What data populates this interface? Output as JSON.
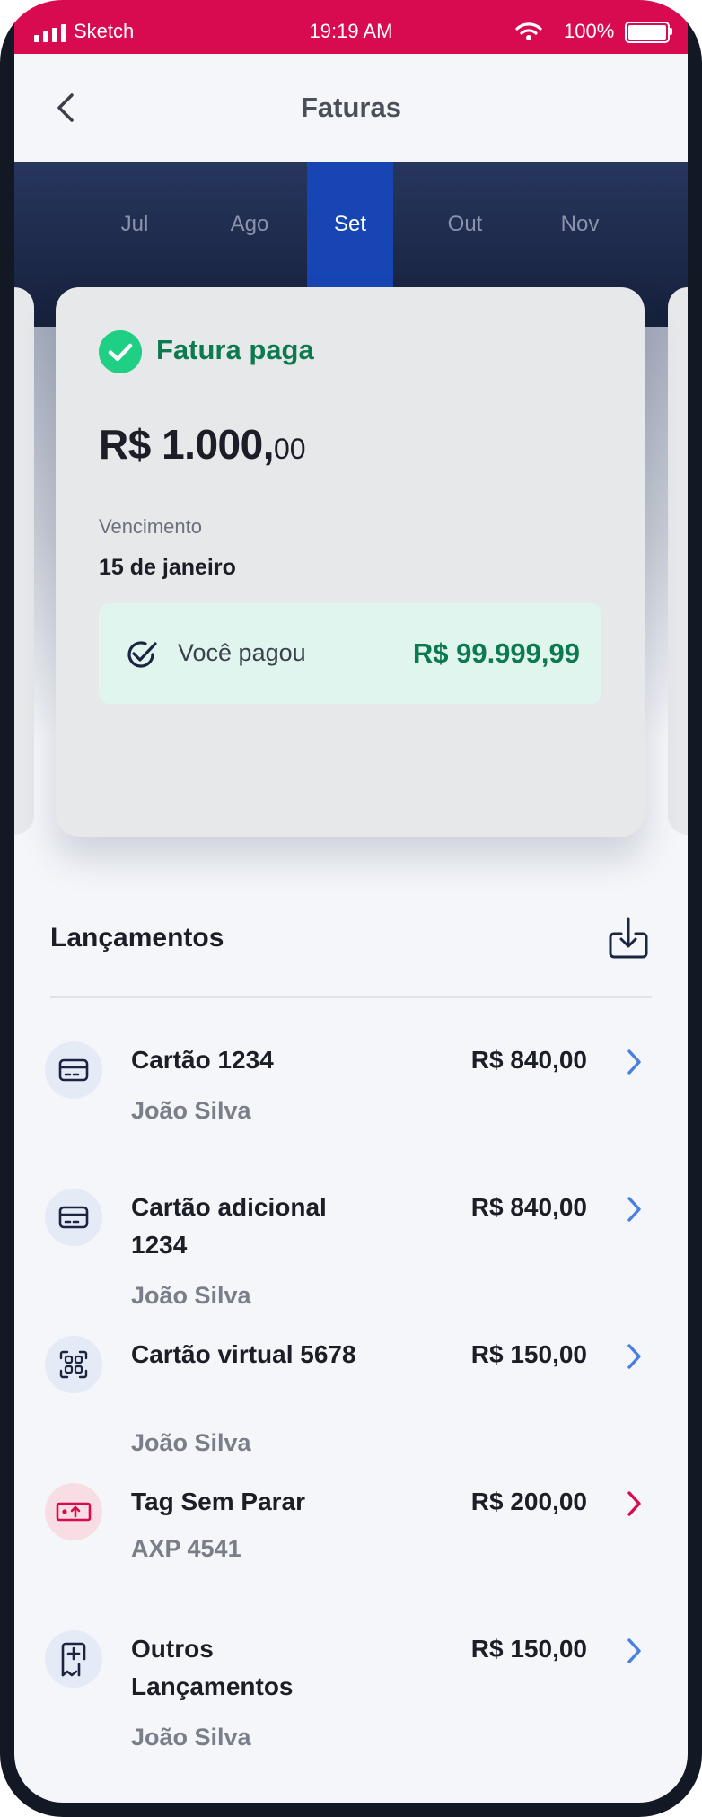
{
  "status_bar": {
    "carrier": "Sketch",
    "time": "19:19 AM",
    "battery": "100%"
  },
  "nav": {
    "title": "Faturas",
    "back_icon": "chevron-left-icon"
  },
  "months": [
    "Jul",
    "Ago",
    "Set",
    "Out",
    "Nov"
  ],
  "active_month": "Set",
  "invoice": {
    "status": "Fatura paga",
    "status_icon": "check-circle-icon",
    "amount_main": "R$ 1.000,",
    "amount_cents": "00",
    "due_label": "Vencimento",
    "due_date": "15 de janeiro",
    "paid_label": "Você pagou",
    "paid_amount": "R$ 99.999,99"
  },
  "entries_section": {
    "title": "Lançamentos",
    "download_icon": "download-icon"
  },
  "entries": [
    {
      "title": "Cartão 1234",
      "subtitle": "João Silva",
      "amount": "R$ 840,00",
      "icon": "credit-card-icon"
    },
    {
      "title": "Cartão  adicional 1234",
      "subtitle": "João Silva",
      "amount": "R$ 840,00",
      "icon": "credit-card-icon"
    },
    {
      "title": "Cartão  virtual 5678",
      "subtitle": "João Silva",
      "amount": "R$ 150,00",
      "icon": "virtual-card-icon"
    },
    {
      "title": "Tag Sem Parar",
      "subtitle": "AXP 4541",
      "amount": "R$ 200,00",
      "icon": "toll-tag-icon"
    },
    {
      "title": "Outros Lançamentos",
      "subtitle": "João Silva",
      "amount": "R$ 150,00",
      "icon": "receipt-plus-icon"
    }
  ],
  "colors": {
    "brand_red": "#d80a50",
    "navy": "#15203a",
    "active_tab": "#1746b4",
    "success_green": "#0b7a4e",
    "chevron_blue": "#4a7fe0",
    "chevron_red": "#d80a50"
  }
}
